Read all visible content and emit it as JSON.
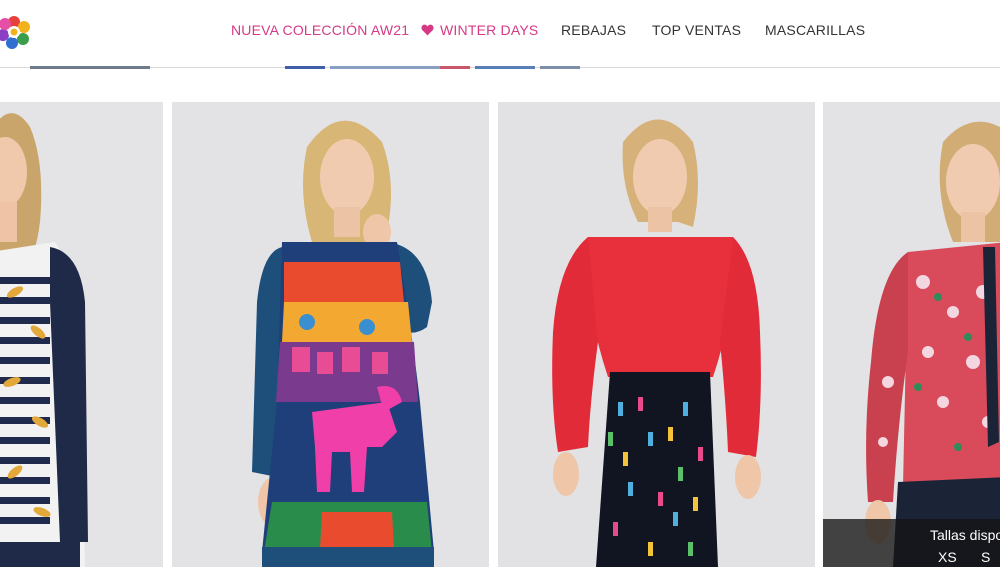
{
  "header": {
    "logo_icon": "flower-logo-icon",
    "nav": [
      {
        "label": "NUEVA COLECCIÓN AW21",
        "color": "#d63a86"
      },
      {
        "label": "WINTER DAYS",
        "color": "#d63a86",
        "icon": "heart-icon"
      },
      {
        "label": "REBAJAS",
        "color": "#333333"
      },
      {
        "label": "TOP VENTAS",
        "color": "#333333"
      },
      {
        "label": "MASCARILLAS",
        "color": "#333333"
      }
    ]
  },
  "products": [
    {
      "name": "striped-leaf-cardigan"
    },
    {
      "name": "horse-print-dress"
    },
    {
      "name": "red-blouse-print-skirt"
    },
    {
      "name": "floral-print-shirt"
    }
  ],
  "sizes_overlay": {
    "title": "Tallas dispo",
    "options": [
      "XS",
      "S"
    ]
  },
  "colors": {
    "accent": "#d63a86",
    "text": "#333333"
  }
}
